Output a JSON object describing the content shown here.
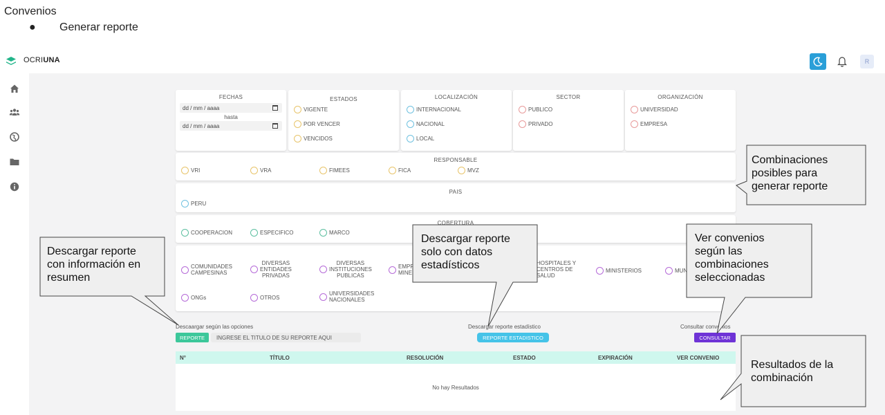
{
  "doc": {
    "title": "Convenios",
    "bullet_marker": "●",
    "bullet": "Generar reporte"
  },
  "app": {
    "brand_prefix": "OCRI",
    "brand_bold": "UNA",
    "avatar_initial": "R",
    "accent": "#2a9fd8"
  },
  "sidebar": {
    "icons": [
      "home-icon",
      "users-icon",
      "globe-icon",
      "folder-icon",
      "info-icon"
    ]
  },
  "filters": {
    "fechas": {
      "title": "FECHAS",
      "date_from": "dd / mm / aaaa",
      "hasta": "hasta",
      "date_to": "dd / mm / aaaa"
    },
    "estados": {
      "title": "ESTADOS",
      "options": [
        "VIGENTE",
        "POR VENCER",
        "VENCIDOS"
      ]
    },
    "localizacion": {
      "title": "LOCALIZACIÓN",
      "options": [
        "INTERNACIONAL",
        "NACIONAL",
        "LOCAL"
      ]
    },
    "sector": {
      "title": "SECTOR",
      "options": [
        "PUBLICO",
        "PRIVADO"
      ]
    },
    "organizacion": {
      "title": "ORGANIZACIÓN",
      "options": [
        "UNIVERSIDAD",
        "EMPRESA"
      ]
    },
    "responsable": {
      "title": "RESPONSABLE",
      "options": [
        "VRI",
        "VRA",
        "FIMEES",
        "FICA",
        "MVZ"
      ]
    },
    "pais": {
      "title": "PAIS",
      "options": [
        "PERU"
      ]
    },
    "cobertura": {
      "title": "COBERTURA",
      "options": [
        "COOPERACION",
        "ESPECIFICO",
        "MARCO"
      ]
    },
    "entidades": {
      "row1": [
        {
          "l1": "COMUNIDADES",
          "l2": "CAMPESINAS",
          "l3": ""
        },
        {
          "l1": "DIVERSAS",
          "l2": "ENTIDADES",
          "l3": "PRIVADAS"
        },
        {
          "l1": "DIVERSAS",
          "l2": "INSTITUCIONES",
          "l3": "PUBLICAS"
        },
        {
          "l1": "EMPR",
          "l2": "MINE",
          "l3": ""
        },
        {
          "l1": "HOSPITALES Y",
          "l2": "CENTROS DE",
          "l3": "SALUD"
        },
        {
          "l1": "MINISTERIOS",
          "l2": "",
          "l3": ""
        },
        {
          "l1": "MUN",
          "l2": "",
          "l3": ""
        }
      ],
      "row2": [
        {
          "l1": "ONGs",
          "l2": ""
        },
        {
          "l1": "OTROS",
          "l2": ""
        },
        {
          "l1": "UNIVERSIDADES",
          "l2": "NACIONALES"
        }
      ]
    }
  },
  "actions": {
    "download_label": "Descaargar según las opciones",
    "report_button": "REPORTE",
    "title_placeholder": "INGRESE EL TITULO DE SU REPORTE AQUI",
    "stats_label": "Descargar reporte estadístico",
    "stats_button": "REPORTE ESTADISTICO",
    "consult_label": "Consultar convenios",
    "consult_button": "CONSULTAR"
  },
  "table": {
    "columns": [
      "N°",
      "TÍTULO",
      "RESOLUCIÓN",
      "ESTADO",
      "EXPIRACIÓN",
      "VER CONVENIO"
    ],
    "empty_text": "No hay Resultados"
  },
  "callouts": {
    "combinaciones": [
      "Combinaciones",
      "posibles para",
      "generar reporte"
    ],
    "resumen": [
      "Descargar reporte",
      "con información en",
      "resumen"
    ],
    "estadisticos": [
      "Descargar reporte",
      "solo con datos",
      "estadísticos"
    ],
    "ver": [
      "Ver convenios",
      "según las",
      "combinaciones",
      "seleccionadas"
    ],
    "resultados": [
      "Resultados de la",
      "combinación"
    ]
  }
}
